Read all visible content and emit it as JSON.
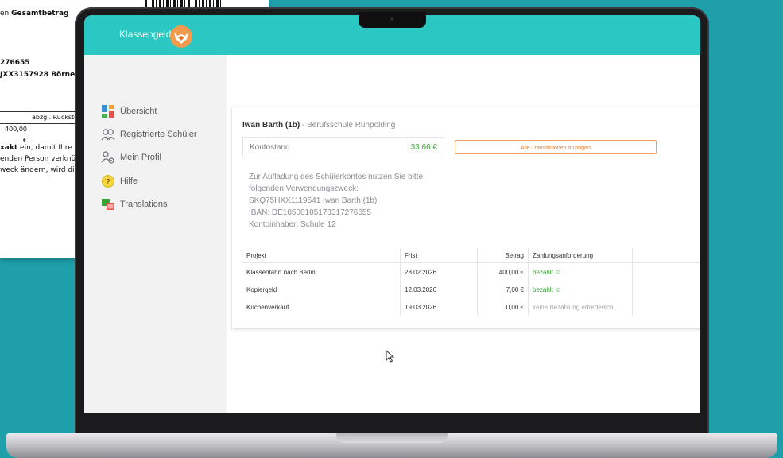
{
  "paper": {
    "line1_prefix": "en ",
    "line1_bold": "Gesamtbetrag",
    "line2": "276655",
    "line3": "JXX3157928 Börner",
    "table_header": "abzgl. Rückste",
    "table_value": "400,00 €",
    "line4_bold": "xakt",
    "line4_rest": " ein, damit Ihre Z",
    "line5": "enden Person verknüp",
    "line6": "weck ändern, wird di"
  },
  "app": {
    "brand": "Klassengeld",
    "logo_icon": "fox-logo-icon"
  },
  "sidebar": {
    "items": [
      {
        "label": "Übersicht",
        "icon": "dashboard-icon"
      },
      {
        "label": "Registrierte Schüler",
        "icon": "users-icon"
      },
      {
        "label": "Mein Profil",
        "icon": "profile-settings-icon"
      },
      {
        "label": "Hilfe",
        "icon": "help-icon"
      },
      {
        "label": "Translations",
        "icon": "translate-icon"
      }
    ]
  },
  "account": {
    "student": "Iwan Barth (1b)",
    "school": " - Berufsschule Ruhpolding",
    "balance_label": "Kontostand",
    "balance_value": "33,66 €",
    "all_transactions_button": "Alle Transaktionen anzeigen",
    "info_lines": [
      "Zur Aufladung des Schülerkontos nutzen Sie bitte",
      "folgenden Verwendungszweck:",
      "SKQ75HXX1119541 Iwan Barth (1b)",
      "IBAN: DE10500105178317276655",
      "Kontoinhaber: Schule 12"
    ]
  },
  "table": {
    "headers": {
      "project": "Projekt",
      "deadline": "Frist",
      "amount": "Betrag",
      "status": "Zahlungsanforderung"
    },
    "rows": [
      {
        "project": "Klassenfahrt nach Berlin",
        "deadline": "28.02.2026",
        "amount": "400,00 €",
        "status": "bezahlt",
        "status_icon": "smile-icon"
      },
      {
        "project": "Kopiergeld",
        "deadline": "12.03.2026",
        "amount": "7,00 €",
        "status": "bezahlt",
        "status_icon": "smile-icon"
      },
      {
        "project": "Kuchenverkauf",
        "deadline": "19.03.2026",
        "amount": "0,00 €",
        "status": "keine Bezahlung erforderlich",
        "status_icon": ""
      }
    ]
  },
  "colors": {
    "topbar": "#2bc8c3",
    "paid": "#3aa335",
    "accent": "#e8813a"
  }
}
